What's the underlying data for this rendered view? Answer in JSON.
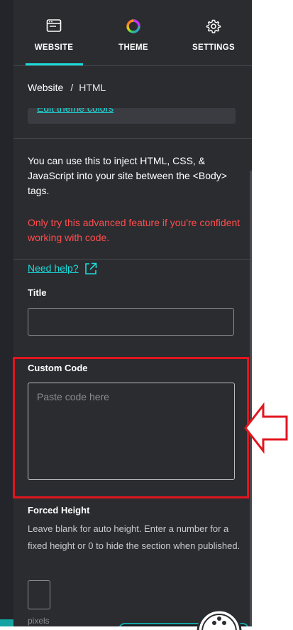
{
  "tabs": [
    {
      "label": "WEBSITE",
      "icon": "browser-window-icon",
      "active": true
    },
    {
      "label": "THEME",
      "icon": "color-wheel-icon",
      "active": false
    },
    {
      "label": "SETTINGS",
      "icon": "gear-icon",
      "active": false
    }
  ],
  "breadcrumb": {
    "root": "Website",
    "separator": "/",
    "current": "HTML"
  },
  "clipped_link": "Edit theme colors",
  "info_text": "You can use this to inject HTML, CSS, & JavaScript into your site between the <Body> tags.",
  "warning_text": "Only try this advanced feature if you're confident working with code.",
  "help": {
    "label": "Need help?",
    "icon": "external-link-icon"
  },
  "title_field": {
    "label": "Title",
    "value": "",
    "placeholder": ""
  },
  "custom_code": {
    "label": "Custom Code",
    "value": "",
    "placeholder": "Paste code here"
  },
  "forced_height": {
    "label": "Forced Height",
    "description": "Leave blank for auto height. Enter a number for a fixed height or 0 to hide the section when published.",
    "value": "",
    "unit": "pixels"
  },
  "colors": {
    "panel_bg": "#2b2c30",
    "accent": "#1bdbdb",
    "warning": "#ff4d4d",
    "annotation": "#e0161f"
  }
}
